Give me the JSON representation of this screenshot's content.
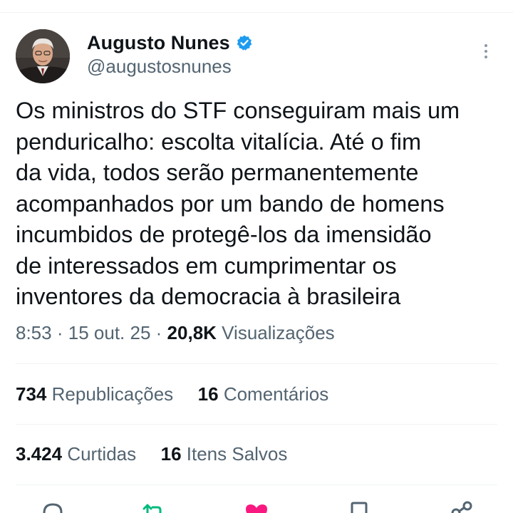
{
  "author": {
    "name": "Augusto Nunes",
    "handle": "@augustosnunes",
    "verified_icon": "verified-badge-icon"
  },
  "tweet": {
    "lines": [
      "Os ministros do STF conseguiram mais um",
      "penduricalho: escolta vitalícia. Até o fim",
      "da vida, todos serão permanentemente",
      "acompanhados por um bando de homens",
      "incumbidos de protegê-los da imensidão",
      "de interessados em cumprimentar os",
      "inventores da democracia à brasileira"
    ]
  },
  "meta": {
    "time": "8:53",
    "date": "15 out. 25",
    "views_count": "20,8K",
    "views_label": "Visualizações",
    "separator": "·"
  },
  "stats": {
    "reposts_count": "734",
    "reposts_label": "Republicações",
    "comments_count": "16",
    "comments_label": "Comentários",
    "likes_count": "3.424",
    "likes_label": "Curtidas",
    "saves_count": "16",
    "saves_label": "Itens Salvos"
  },
  "actions": [
    {
      "icon": "reply-icon"
    },
    {
      "icon": "repost-icon"
    },
    {
      "icon": "like-icon"
    },
    {
      "icon": "bookmark-icon"
    },
    {
      "icon": "share-icon"
    }
  ],
  "colors": {
    "text": "#0f1419",
    "secondary": "#536471",
    "verified": "#1d9bf0",
    "repost": "#00ba7c",
    "like": "#f91880",
    "divider": "#eff3f4"
  }
}
